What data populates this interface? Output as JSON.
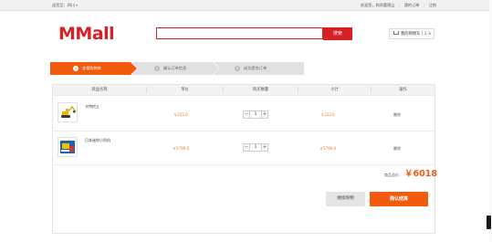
{
  "topbar": {
    "location_label": "送货至：四川",
    "links": [
      "欢迎您，和尚要爬山",
      "我的订单",
      "注销"
    ]
  },
  "header": {
    "logo_text": "MMall",
    "search_placeholder": "",
    "search_button": "搜索",
    "cart_label": "我的购物车",
    "cart_count": "[ 2 ]"
  },
  "steps": [
    {
      "number": "1",
      "label": "查看购物车"
    },
    {
      "number": "2",
      "label": "确认订单信息"
    },
    {
      "number": "3",
      "label": "成功提交订单"
    }
  ],
  "table": {
    "columns": [
      "商品名称",
      "单价",
      "购买数量",
      "小计",
      "操作"
    ],
    "rows": [
      {
        "name": "卡特挖土",
        "price": "￥222.0",
        "quantity": "1",
        "subtotal": "￥222.0",
        "action": "删除"
      },
      {
        "name": "日本迷你小吊机",
        "price": "￥5796.0",
        "quantity": "1",
        "subtotal": "￥5796.0",
        "action": "删除"
      }
    ]
  },
  "summary": {
    "total_label": "商品总价：",
    "total_value": "￥6018"
  },
  "actions": {
    "continue_label": "继续购物",
    "confirm_label": "确认结算"
  },
  "colors": {
    "brand_red": "#d71f26",
    "accent_orange": "#f25a10"
  }
}
